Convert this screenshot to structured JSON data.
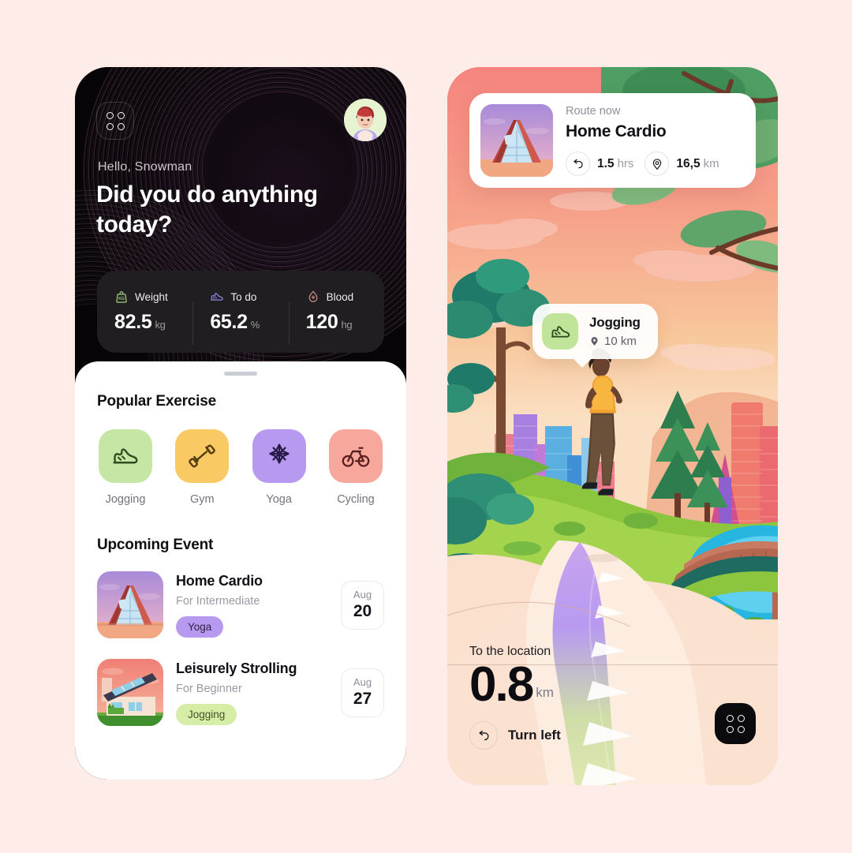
{
  "theme": {
    "page_bg": "#fdece7",
    "dark_card": "#070507",
    "accent_green": "#bfe49a",
    "accent_yellow": "#f9c964",
    "accent_purple": "#b79af0",
    "accent_coral": "#f7a79b",
    "sky_coral": "#f5847f"
  },
  "left_phone": {
    "header": {
      "menu_icon": "grid-dots-icon",
      "avatar_icon": "user-avatar",
      "greeting": "Hello, Snowman",
      "headline": "Did you do anything today?"
    },
    "stats": [
      {
        "icon": "weight-bag-icon",
        "label": "Weight",
        "value": "82.5",
        "unit": "kg",
        "color": "#9ec97a"
      },
      {
        "icon": "shoe-icon",
        "label": "To do",
        "value": "65.2",
        "unit": "%",
        "color": "#8f86e0"
      },
      {
        "icon": "blood-drop-icon",
        "label": "Blood",
        "value": "120",
        "unit": "hg",
        "color": "#c98a88"
      }
    ],
    "popular_exercise": {
      "title": "Popular Exercise",
      "items": [
        {
          "label": "Jogging",
          "icon": "shoe-icon",
          "tile_color": "#c6e6a6",
          "stroke": "#2f4d1f"
        },
        {
          "label": "Gym",
          "icon": "dumbbell-icon",
          "tile_color": "#f9c964",
          "stroke": "#533c10"
        },
        {
          "label": "Yoga",
          "icon": "lotus-flower-icon",
          "tile_color": "#b79af0",
          "stroke": "#2a1c4a"
        },
        {
          "label": "Cycling",
          "icon": "bicycle-icon",
          "tile_color": "#f7a79b",
          "stroke": "#5a1f1c"
        }
      ]
    },
    "upcoming_event": {
      "title": "Upcoming Event",
      "items": [
        {
          "thumb": "a-frame-house-thumb",
          "title": "Home Cardio",
          "subtitle": "For Intermediate",
          "tag": "Yoga",
          "tag_bg": "#b79af0",
          "tag_color": "#2e2346",
          "month": "Aug",
          "day": "20"
        },
        {
          "thumb": "modern-house-thumb",
          "title": "Leisurely Strolling",
          "subtitle": "For Beginner",
          "tag": "Jogging",
          "tag_bg": "#d6eda8",
          "tag_color": "#3e5423",
          "month": "Aug",
          "day": "27"
        }
      ]
    }
  },
  "right_phone": {
    "route_card": {
      "thumb": "a-frame-house-thumb",
      "eyebrow": "Route now",
      "title": "Home Cardio",
      "metrics": [
        {
          "icon": "turn-left-arrow-icon",
          "value": "1.5",
          "unit": "hrs"
        },
        {
          "icon": "location-pin-icon",
          "value": "16,5",
          "unit": "km"
        }
      ]
    },
    "map_tooltip": {
      "icon": "shoe-icon",
      "title": "Jogging",
      "pin_icon": "location-pin-icon",
      "distance": "10 km"
    },
    "navigation": {
      "eyebrow": "To the location",
      "distance": "0.8",
      "unit": "km",
      "turn_icon": "turn-left-arrow-icon",
      "turn_label": "Turn left"
    },
    "fab": {
      "icon": "grid-dots-icon"
    }
  }
}
